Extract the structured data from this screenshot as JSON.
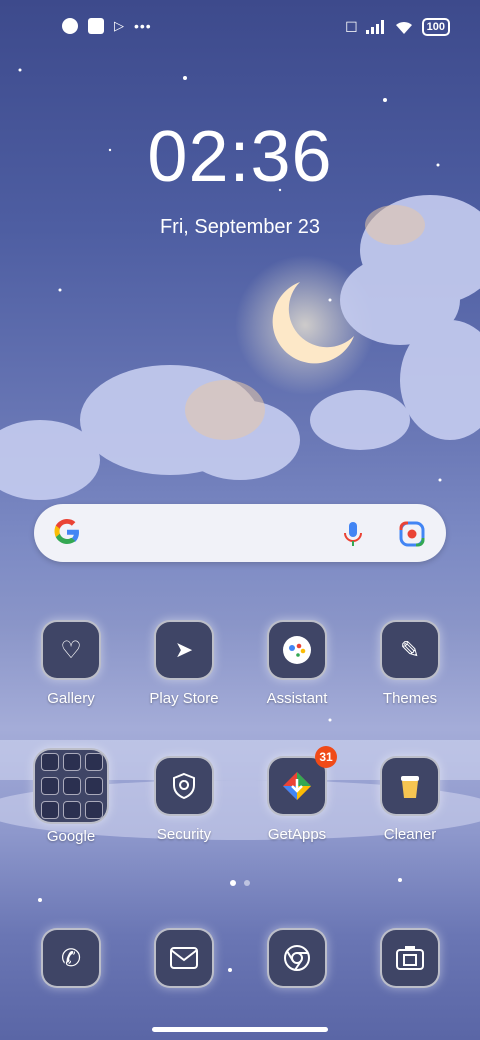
{
  "status_bar": {
    "battery": "100",
    "more": "•••"
  },
  "clock": {
    "time": "02:36",
    "date": "Fri, September 23"
  },
  "search": {
    "engine": "Google"
  },
  "apps_row1": [
    {
      "label": "Gallery",
      "icon": "gallery-icon"
    },
    {
      "label": "Play Store",
      "icon": "play-store-icon"
    },
    {
      "label": "Assistant",
      "icon": "assistant-icon"
    },
    {
      "label": "Themes",
      "icon": "themes-icon"
    }
  ],
  "apps_row2": [
    {
      "label": "Google",
      "icon": "google-folder-icon"
    },
    {
      "label": "Security",
      "icon": "security-icon"
    },
    {
      "label": "GetApps",
      "icon": "getapps-icon",
      "badge": "31"
    },
    {
      "label": "Cleaner",
      "icon": "cleaner-icon"
    }
  ],
  "dock": [
    {
      "icon": "phone-icon"
    },
    {
      "icon": "messaging-icon"
    },
    {
      "icon": "chrome-icon"
    },
    {
      "icon": "camera-icon"
    }
  ],
  "colors": {
    "badge": "#f04a18",
    "tile": "#3f4566"
  }
}
